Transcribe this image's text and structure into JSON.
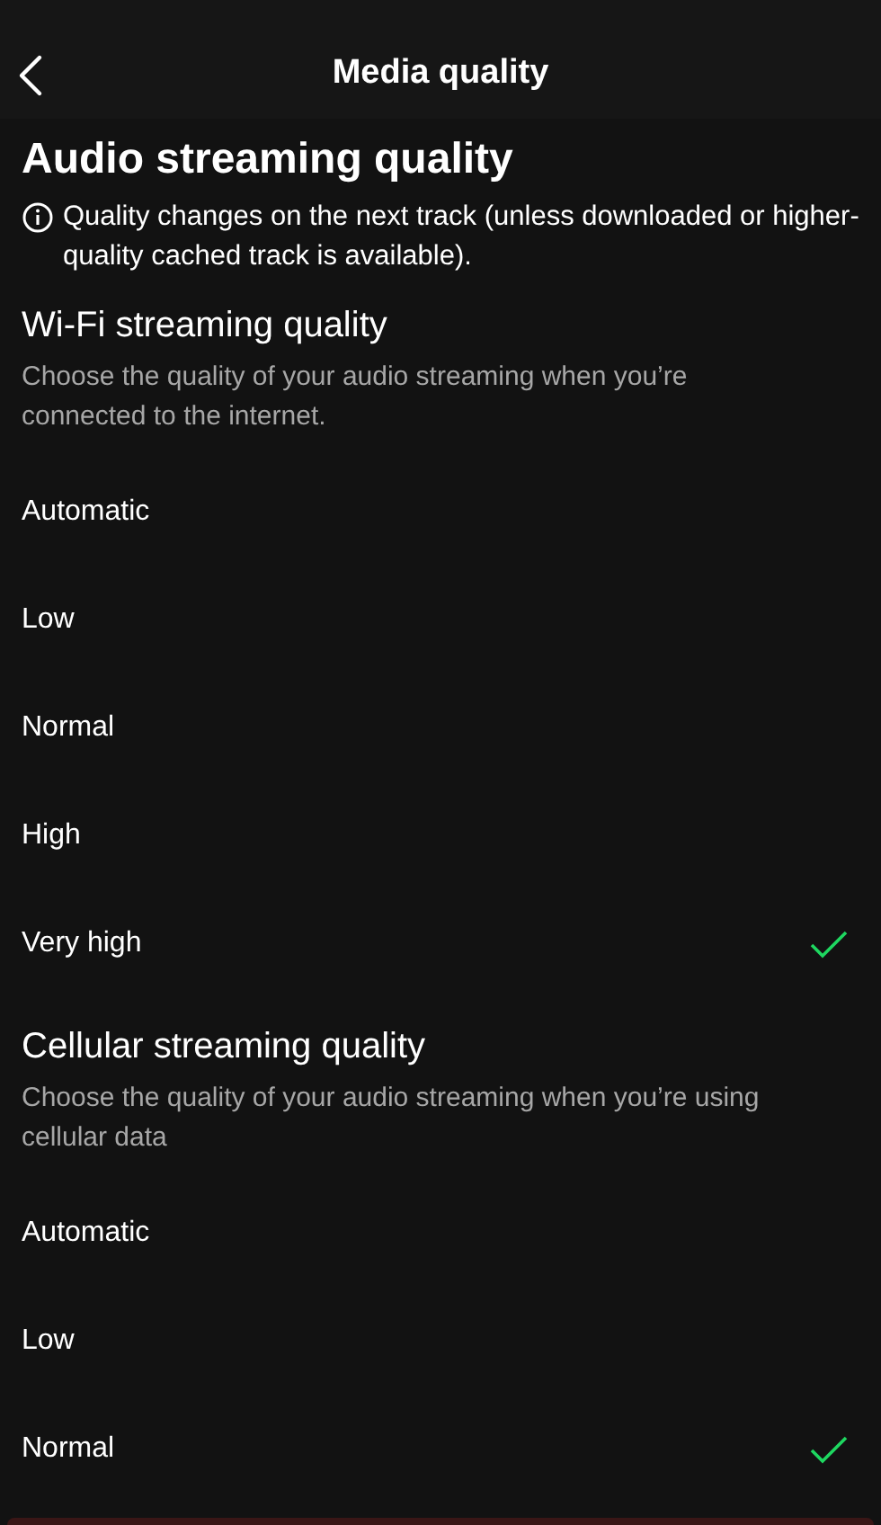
{
  "header": {
    "title": "Media quality"
  },
  "heading": "Audio streaming quality",
  "note": "Quality changes on the next track (unless downloaded or higher-quality cached track is available).",
  "sections": [
    {
      "title": "Wi-Fi streaming quality",
      "description": "Choose the quality of your audio streaming when you’re connected to the internet.",
      "options": [
        {
          "label": "Automatic",
          "selected": false
        },
        {
          "label": "Low",
          "selected": false
        },
        {
          "label": "Normal",
          "selected": false
        },
        {
          "label": "High",
          "selected": false
        },
        {
          "label": "Very high",
          "selected": true
        }
      ]
    },
    {
      "title": "Cellular streaming quality",
      "description": "Choose the quality of your audio streaming when you’re using cellular data",
      "options": [
        {
          "label": "Automatic",
          "selected": false
        },
        {
          "label": "Low",
          "selected": false
        },
        {
          "label": "Normal",
          "selected": true
        }
      ]
    }
  ]
}
